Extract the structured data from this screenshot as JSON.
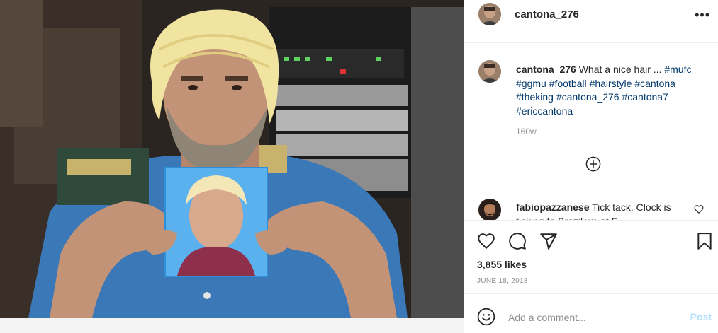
{
  "header": {
    "username": "cantona_276",
    "more_label": "•••"
  },
  "caption": {
    "username": "cantona_276",
    "text": "What a nice hair ...",
    "hashtags": [
      "#mufc",
      "#ggmu",
      "#football",
      "#hairstyle",
      "#cantona",
      "#theking",
      "#cantona_276",
      "#cantona7",
      "#ericcantona"
    ],
    "time": "160w"
  },
  "comment": {
    "username": "fabiopazzanese",
    "text": "Tick tack. Clock is ticking to Brazil wc at F..."
  },
  "actions": {
    "likes": "3,855 likes",
    "date": "JUNE 18, 2018"
  },
  "add_comment": {
    "placeholder": "Add a comment...",
    "post_label": "Post"
  },
  "icons": {
    "like": "heart-icon",
    "comment": "comment-bubble-icon",
    "share": "paper-plane-icon",
    "save": "bookmark-icon",
    "emoji": "smiley-icon",
    "load_more": "plus-circle-icon",
    "comment_like": "heart-small-icon"
  },
  "colors": {
    "link": "#00376b",
    "muted": "#8e8e8e",
    "post_disabled": "#b2dffc"
  }
}
